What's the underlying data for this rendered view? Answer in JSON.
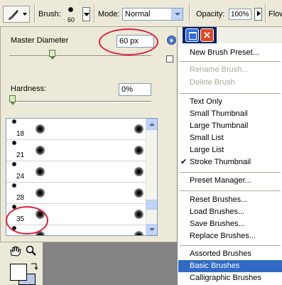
{
  "options_bar": {
    "brush_label": "Brush:",
    "brush_size": "60",
    "mode_label": "Mode:",
    "mode_value": "Normal",
    "opacity_label": "Opacity:",
    "opacity_value": "100%",
    "flow_label": "Flow"
  },
  "brush_panel": {
    "master_diameter_label": "Master Diameter",
    "master_diameter_value": "60 px",
    "master_diameter_slider_fraction": 0.3,
    "hardness_label": "Hardness:",
    "hardness_value": "0%",
    "hardness_slider_fraction": 0.0,
    "presets": [
      {
        "size": "18"
      },
      {
        "size": "21"
      },
      {
        "size": "24"
      },
      {
        "size": "28"
      },
      {
        "size": "35"
      },
      {
        "size": ""
      }
    ]
  },
  "window_buttons": {
    "close_glyph": "✕"
  },
  "menu": {
    "items": [
      {
        "label": "New Brush Preset...",
        "disabled": false
      },
      {
        "label": "Rename Brush...",
        "disabled": true
      },
      {
        "label": "Delete Brush",
        "disabled": true
      },
      {
        "label": "Text Only",
        "disabled": false
      },
      {
        "label": "Small Thumbnail",
        "disabled": false
      },
      {
        "label": "Large Thumbnail",
        "disabled": false
      },
      {
        "label": "Small List",
        "disabled": false
      },
      {
        "label": "Large List",
        "disabled": false
      },
      {
        "label": "Stroke Thumbnail",
        "disabled": false,
        "checked": true
      },
      {
        "label": "Preset Manager...",
        "disabled": false
      },
      {
        "label": "Reset Brushes...",
        "disabled": false
      },
      {
        "label": "Load Brushes...",
        "disabled": false
      },
      {
        "label": "Save Brushes...",
        "disabled": false
      },
      {
        "label": "Replace Brushes...",
        "disabled": false
      },
      {
        "label": "Assorted Brushes",
        "disabled": false
      },
      {
        "label": "Basic Brushes",
        "disabled": false,
        "selected": true
      },
      {
        "label": "Calligraphic Brushes",
        "disabled": false
      }
    ],
    "check_glyph": "✔"
  },
  "colors": {
    "highlight": "#316ac5",
    "annotation": "#e0203c",
    "background_color_swatch": "#bcc8e8"
  }
}
